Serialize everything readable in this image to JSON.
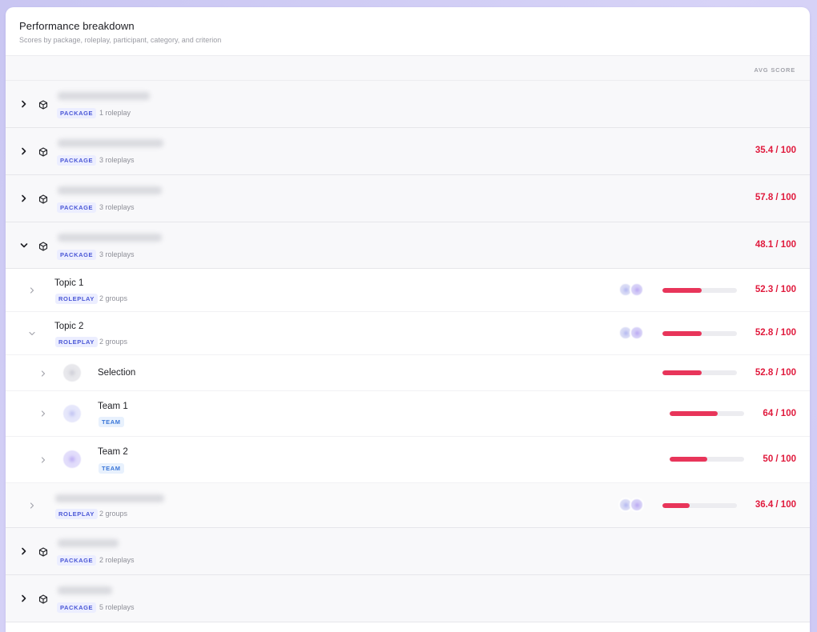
{
  "header": {
    "title": "Performance breakdown",
    "subtitle": "Scores by package, roleplay, participant, category, and criterion"
  },
  "columns": {
    "avg_score": "AVG SCORE"
  },
  "icons": {
    "expand": "chevron-right-icon",
    "collapse": "chevron-down-icon",
    "package": "cube-icon"
  },
  "colors": {
    "score": "#e0193c",
    "bar_fill": "#e8355a",
    "badge_package": "#4a57d6",
    "badge_team": "#3a76d8"
  },
  "packages": [
    {
      "badge": "PACKAGE",
      "meta": "1 roleplay",
      "score": ""
    },
    {
      "badge": "PACKAGE",
      "meta": "3 roleplays",
      "score": "35.4 / 100"
    },
    {
      "badge": "PACKAGE",
      "meta": "3 roleplays",
      "score": "57.8 / 100"
    },
    {
      "badge": "PACKAGE",
      "meta": "3 roleplays",
      "score": "48.1 / 100"
    },
    {
      "badge": "PACKAGE",
      "meta": "2 roleplays",
      "score": ""
    },
    {
      "badge": "PACKAGE",
      "meta": "5 roleplays",
      "score": ""
    }
  ],
  "roleplays": [
    {
      "title": "Topic 1",
      "badge": "ROLEPLAY",
      "meta": "2 groups",
      "score": "52.3 / 100",
      "progress": 0.523
    },
    {
      "title": "Topic 2",
      "badge": "ROLEPLAY",
      "meta": "2 groups",
      "score": "52.8 / 100",
      "progress": 0.528
    },
    {
      "title": "",
      "badge": "ROLEPLAY",
      "meta": "2 groups",
      "score": "36.4 / 100",
      "progress": 0.364
    }
  ],
  "groups": [
    {
      "title": "Selection",
      "badge": "",
      "score": "52.8 / 100",
      "progress": 0.528
    },
    {
      "title": "Team 1",
      "badge": "TEAM",
      "score": "64 / 100",
      "progress": 0.64
    },
    {
      "title": "Team 2",
      "badge": "TEAM",
      "score": "50 / 100",
      "progress": 0.5
    }
  ]
}
